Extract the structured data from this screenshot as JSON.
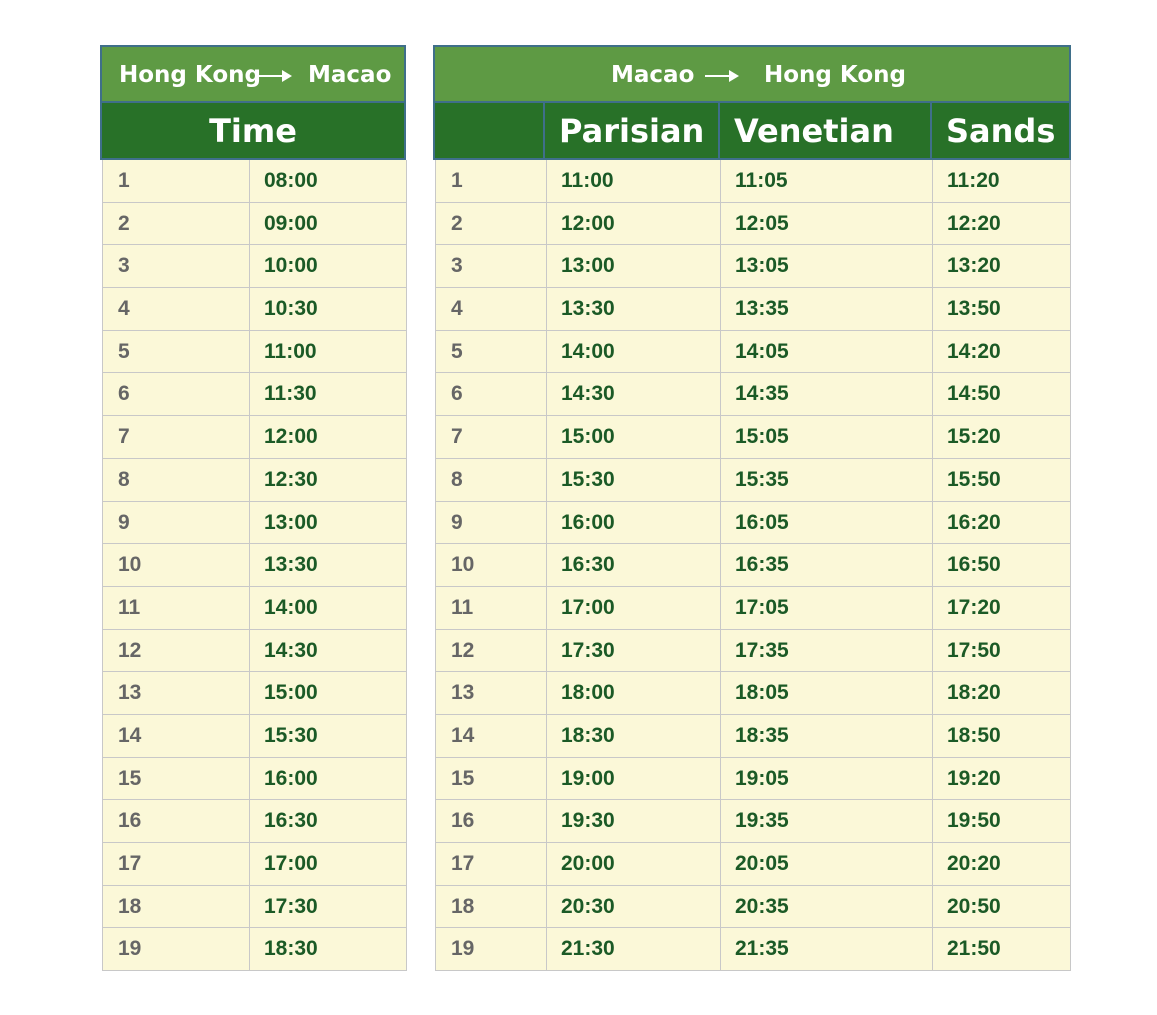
{
  "hk_to_macao": {
    "from": "Hong Kong",
    "to": "Macao",
    "column_header": "Time",
    "rows": [
      {
        "no": "1",
        "time": "08:00"
      },
      {
        "no": "2",
        "time": "09:00"
      },
      {
        "no": "3",
        "time": "10:00"
      },
      {
        "no": "4",
        "time": "10:30"
      },
      {
        "no": "5",
        "time": "11:00"
      },
      {
        "no": "6",
        "time": "11:30"
      },
      {
        "no": "7",
        "time": "12:00"
      },
      {
        "no": "8",
        "time": "12:30"
      },
      {
        "no": "9",
        "time": "13:00"
      },
      {
        "no": "10",
        "time": "13:30"
      },
      {
        "no": "11",
        "time": "14:00"
      },
      {
        "no": "12",
        "time": "14:30"
      },
      {
        "no": "13",
        "time": "15:00"
      },
      {
        "no": "14",
        "time": "15:30"
      },
      {
        "no": "15",
        "time": "16:00"
      },
      {
        "no": "16",
        "time": "16:30"
      },
      {
        "no": "17",
        "time": "17:00"
      },
      {
        "no": "18",
        "time": "17:30"
      },
      {
        "no": "19",
        "time": "18:30"
      }
    ]
  },
  "macao_to_hk": {
    "from": "Macao",
    "to": "Hong Kong",
    "columns": [
      "",
      "Parisian",
      "Venetian",
      "Sands"
    ],
    "rows": [
      {
        "no": "1",
        "parisian": "11:00",
        "venetian": "11:05",
        "sands": "11:20"
      },
      {
        "no": "2",
        "parisian": "12:00",
        "venetian": "12:05",
        "sands": "12:20"
      },
      {
        "no": "3",
        "parisian": "13:00",
        "venetian": "13:05",
        "sands": "13:20"
      },
      {
        "no": "4",
        "parisian": "13:30",
        "venetian": "13:35",
        "sands": "13:50"
      },
      {
        "no": "5",
        "parisian": "14:00",
        "venetian": "14:05",
        "sands": "14:20"
      },
      {
        "no": "6",
        "parisian": "14:30",
        "venetian": "14:35",
        "sands": "14:50"
      },
      {
        "no": "7",
        "parisian": "15:00",
        "venetian": "15:05",
        "sands": "15:20"
      },
      {
        "no": "8",
        "parisian": "15:30",
        "venetian": "15:35",
        "sands": "15:50"
      },
      {
        "no": "9",
        "parisian": "16:00",
        "venetian": "16:05",
        "sands": "16:20"
      },
      {
        "no": "10",
        "parisian": "16:30",
        "venetian": "16:35",
        "sands": "16:50"
      },
      {
        "no": "11",
        "parisian": "17:00",
        "venetian": "17:05",
        "sands": "17:20"
      },
      {
        "no": "12",
        "parisian": "17:30",
        "venetian": "17:35",
        "sands": "17:50"
      },
      {
        "no": "13",
        "parisian": "18:00",
        "venetian": "18:05",
        "sands": "18:20"
      },
      {
        "no": "14",
        "parisian": "18:30",
        "venetian": "18:35",
        "sands": "18:50"
      },
      {
        "no": "15",
        "parisian": "19:00",
        "venetian": "19:05",
        "sands": "19:20"
      },
      {
        "no": "16",
        "parisian": "19:30",
        "venetian": "19:35",
        "sands": "19:50"
      },
      {
        "no": "17",
        "parisian": "20:00",
        "venetian": "20:05",
        "sands": "20:20"
      },
      {
        "no": "18",
        "parisian": "20:30",
        "venetian": "20:35",
        "sands": "20:50"
      },
      {
        "no": "19",
        "parisian": "21:30",
        "venetian": "21:35",
        "sands": "21:50"
      }
    ]
  },
  "colors": {
    "route_header_bg": "#5e9a44",
    "column_header_bg": "#287128",
    "cell_bg": "#fbf8d8",
    "time_text": "#1b5a26",
    "number_text": "#666666"
  }
}
